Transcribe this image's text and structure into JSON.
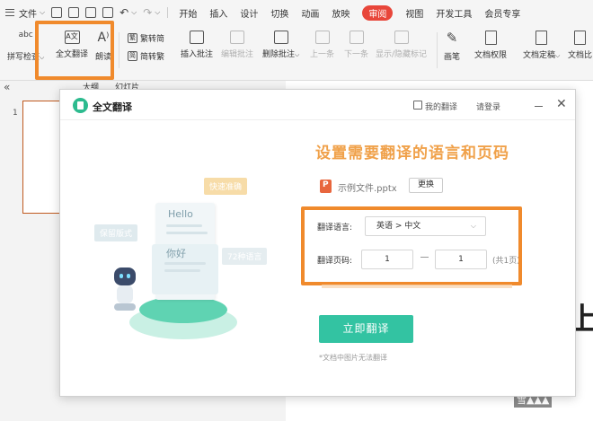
{
  "menubar": {
    "file_label": "文件",
    "items": [
      {
        "label": "开始",
        "active": false
      },
      {
        "label": "插入",
        "active": false
      },
      {
        "label": "设计",
        "active": false
      },
      {
        "label": "切换",
        "active": false
      },
      {
        "label": "动画",
        "active": false
      },
      {
        "label": "放映",
        "active": false
      },
      {
        "label": "审阅",
        "active": true
      },
      {
        "label": "视图",
        "active": false
      },
      {
        "label": "开发工具",
        "active": false
      },
      {
        "label": "会员专享",
        "active": false
      }
    ]
  },
  "ribbon": {
    "spellcheck": {
      "icon_text": "abc",
      "label": "拼写检查"
    },
    "full_translate": {
      "icon_text": "A文",
      "label": "全文翻译"
    },
    "read_aloud": {
      "label": "朗读"
    },
    "trad_simp": {
      "to_traditional": "繁转简",
      "to_simplified": "简转繁"
    },
    "insert_comment": "插入批注",
    "edit_comment": "编辑批注",
    "delete_comment": "删除批注",
    "prev": "上一条",
    "next": "下一条",
    "show_hide_marks": "显示/隐藏标记",
    "pen": "画笔",
    "doc_permission": "文档权限",
    "doc_finalize": "文档定稿",
    "doc_compare": "文档比"
  },
  "panel": {
    "tab_outline": "大纲",
    "tab_slides": "幻灯片",
    "slide_number": "1"
  },
  "canvas": {
    "partial_text": "上",
    "watermark": "雪▲▲▲"
  },
  "dialog": {
    "title": "全文翻译",
    "my_translations": "我的翻译",
    "login": "请登录",
    "headline": "设置需要翻译的语言和页码",
    "filename": "示例文件.pptx",
    "change_button": "更换",
    "language_label": "翻译语言:",
    "language_value": "英语 > 中文",
    "pages_label": "翻译页码:",
    "page_from": "1",
    "page_to": "1",
    "page_total": "(共1页)",
    "translate_button": "立即翻译",
    "note": "*文档中图片无法翻译"
  },
  "illustration": {
    "tag_fast": "快速准确",
    "tag_layout": "保留版式",
    "tag_languages": "72种语言",
    "hello": "Hello",
    "nihao": "你好"
  },
  "colors": {
    "accent_red": "#e8463a",
    "highlight_orange": "#f08a2c",
    "headline_orange": "#f0a14a",
    "button_green": "#33c3a2"
  }
}
